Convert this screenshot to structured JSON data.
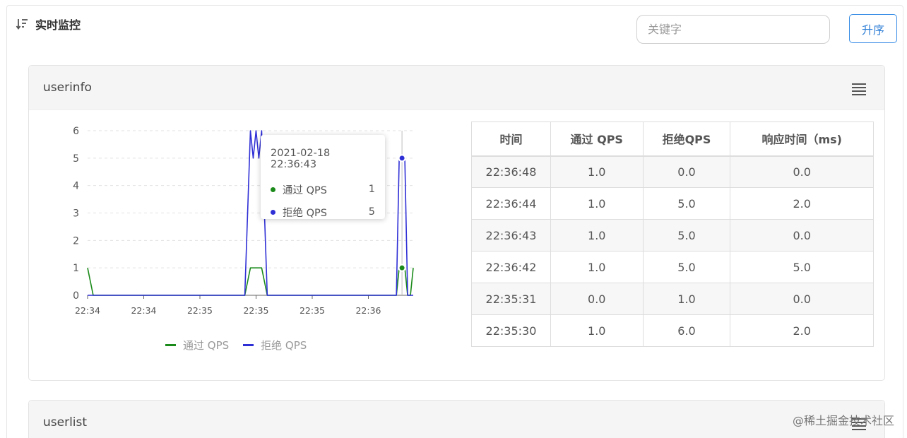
{
  "header": {
    "title": "实时监控",
    "search_placeholder": "关键字",
    "sort_label": "升序"
  },
  "panels": [
    {
      "name": "userinfo"
    },
    {
      "name": "userlist"
    }
  ],
  "chart_data": {
    "type": "line",
    "x_tick_labels": [
      "22:34",
      "22:34",
      "22:35",
      "22:35",
      "22:35",
      "22:36"
    ],
    "y_ticks": [
      0,
      1,
      2,
      3,
      4,
      5,
      6
    ],
    "ylim": [
      0,
      6
    ],
    "grid": true,
    "legend": "bottom",
    "x_minutes": [
      0,
      0.1,
      0.12,
      2.75,
      2.8,
      2.9,
      2.95,
      3.0,
      3.05,
      3.1,
      3.2,
      3.25,
      3.3,
      5.5,
      5.55,
      5.6,
      5.65,
      5.7,
      5.75,
      5.8
    ],
    "series": [
      {
        "name": "通过 QPS",
        "color": "#1a8a1a",
        "values": [
          1,
          0,
          0,
          0,
          0,
          1,
          1,
          1,
          1,
          1,
          0,
          0,
          0,
          0,
          1,
          1,
          1,
          0,
          0,
          1
        ]
      },
      {
        "name": "拒绝 QPS",
        "color": "#2f2fd6",
        "values": [
          0,
          0,
          0,
          0,
          0,
          6,
          5,
          6,
          5,
          6,
          0,
          0,
          0,
          0,
          5,
          5,
          5,
          0,
          0,
          0
        ]
      }
    ],
    "tooltip": {
      "time": "2021-02-18 22:36:43",
      "items": [
        {
          "name": "通过 QPS",
          "value": "1",
          "color": "#1a8a1a"
        },
        {
          "name": "拒绝 QPS",
          "value": "5",
          "color": "#2f2fd6"
        }
      ],
      "x_minute": 5.6
    }
  },
  "table": {
    "columns": [
      "时间",
      "通过 QPS",
      "拒绝QPS",
      "响应时间（ms)"
    ],
    "rows": [
      [
        "22:36:48",
        "1.0",
        "0.0",
        "0.0"
      ],
      [
        "22:36:44",
        "1.0",
        "5.0",
        "2.0"
      ],
      [
        "22:36:43",
        "1.0",
        "5.0",
        "0.0"
      ],
      [
        "22:36:42",
        "1.0",
        "5.0",
        "5.0"
      ],
      [
        "22:35:31",
        "0.0",
        "1.0",
        "0.0"
      ],
      [
        "22:35:30",
        "1.0",
        "6.0",
        "2.0"
      ]
    ]
  },
  "watermark": "@稀土掘金技术社区"
}
